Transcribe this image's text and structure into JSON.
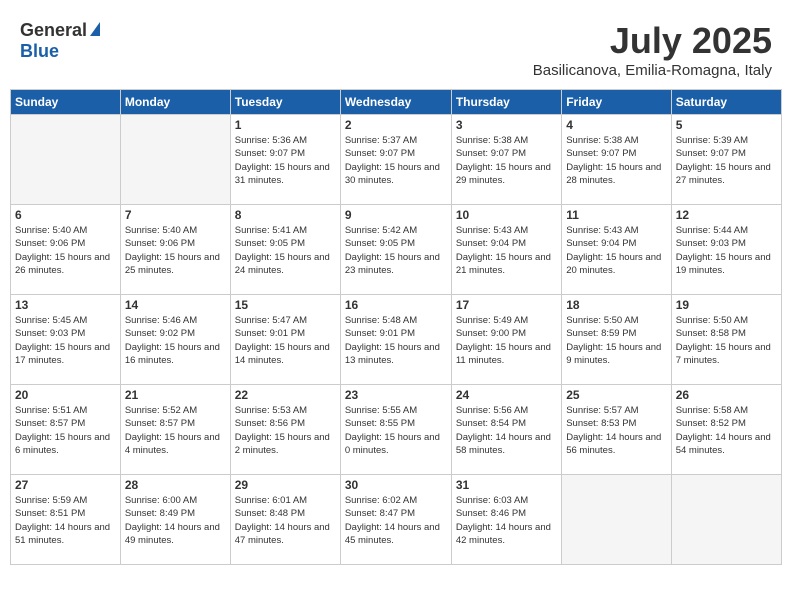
{
  "header": {
    "logo_general": "General",
    "logo_blue": "Blue",
    "month": "July 2025",
    "location": "Basilicanova, Emilia-Romagna, Italy"
  },
  "weekdays": [
    "Sunday",
    "Monday",
    "Tuesday",
    "Wednesday",
    "Thursday",
    "Friday",
    "Saturday"
  ],
  "weeks": [
    [
      {
        "day": "",
        "info": ""
      },
      {
        "day": "",
        "info": ""
      },
      {
        "day": "1",
        "info": "Sunrise: 5:36 AM\nSunset: 9:07 PM\nDaylight: 15 hours\nand 31 minutes."
      },
      {
        "day": "2",
        "info": "Sunrise: 5:37 AM\nSunset: 9:07 PM\nDaylight: 15 hours\nand 30 minutes."
      },
      {
        "day": "3",
        "info": "Sunrise: 5:38 AM\nSunset: 9:07 PM\nDaylight: 15 hours\nand 29 minutes."
      },
      {
        "day": "4",
        "info": "Sunrise: 5:38 AM\nSunset: 9:07 PM\nDaylight: 15 hours\nand 28 minutes."
      },
      {
        "day": "5",
        "info": "Sunrise: 5:39 AM\nSunset: 9:07 PM\nDaylight: 15 hours\nand 27 minutes."
      }
    ],
    [
      {
        "day": "6",
        "info": "Sunrise: 5:40 AM\nSunset: 9:06 PM\nDaylight: 15 hours\nand 26 minutes."
      },
      {
        "day": "7",
        "info": "Sunrise: 5:40 AM\nSunset: 9:06 PM\nDaylight: 15 hours\nand 25 minutes."
      },
      {
        "day": "8",
        "info": "Sunrise: 5:41 AM\nSunset: 9:05 PM\nDaylight: 15 hours\nand 24 minutes."
      },
      {
        "day": "9",
        "info": "Sunrise: 5:42 AM\nSunset: 9:05 PM\nDaylight: 15 hours\nand 23 minutes."
      },
      {
        "day": "10",
        "info": "Sunrise: 5:43 AM\nSunset: 9:04 PM\nDaylight: 15 hours\nand 21 minutes."
      },
      {
        "day": "11",
        "info": "Sunrise: 5:43 AM\nSunset: 9:04 PM\nDaylight: 15 hours\nand 20 minutes."
      },
      {
        "day": "12",
        "info": "Sunrise: 5:44 AM\nSunset: 9:03 PM\nDaylight: 15 hours\nand 19 minutes."
      }
    ],
    [
      {
        "day": "13",
        "info": "Sunrise: 5:45 AM\nSunset: 9:03 PM\nDaylight: 15 hours\nand 17 minutes."
      },
      {
        "day": "14",
        "info": "Sunrise: 5:46 AM\nSunset: 9:02 PM\nDaylight: 15 hours\nand 16 minutes."
      },
      {
        "day": "15",
        "info": "Sunrise: 5:47 AM\nSunset: 9:01 PM\nDaylight: 15 hours\nand 14 minutes."
      },
      {
        "day": "16",
        "info": "Sunrise: 5:48 AM\nSunset: 9:01 PM\nDaylight: 15 hours\nand 13 minutes."
      },
      {
        "day": "17",
        "info": "Sunrise: 5:49 AM\nSunset: 9:00 PM\nDaylight: 15 hours\nand 11 minutes."
      },
      {
        "day": "18",
        "info": "Sunrise: 5:50 AM\nSunset: 8:59 PM\nDaylight: 15 hours\nand 9 minutes."
      },
      {
        "day": "19",
        "info": "Sunrise: 5:50 AM\nSunset: 8:58 PM\nDaylight: 15 hours\nand 7 minutes."
      }
    ],
    [
      {
        "day": "20",
        "info": "Sunrise: 5:51 AM\nSunset: 8:57 PM\nDaylight: 15 hours\nand 6 minutes."
      },
      {
        "day": "21",
        "info": "Sunrise: 5:52 AM\nSunset: 8:57 PM\nDaylight: 15 hours\nand 4 minutes."
      },
      {
        "day": "22",
        "info": "Sunrise: 5:53 AM\nSunset: 8:56 PM\nDaylight: 15 hours\nand 2 minutes."
      },
      {
        "day": "23",
        "info": "Sunrise: 5:55 AM\nSunset: 8:55 PM\nDaylight: 15 hours\nand 0 minutes."
      },
      {
        "day": "24",
        "info": "Sunrise: 5:56 AM\nSunset: 8:54 PM\nDaylight: 14 hours\nand 58 minutes."
      },
      {
        "day": "25",
        "info": "Sunrise: 5:57 AM\nSunset: 8:53 PM\nDaylight: 14 hours\nand 56 minutes."
      },
      {
        "day": "26",
        "info": "Sunrise: 5:58 AM\nSunset: 8:52 PM\nDaylight: 14 hours\nand 54 minutes."
      }
    ],
    [
      {
        "day": "27",
        "info": "Sunrise: 5:59 AM\nSunset: 8:51 PM\nDaylight: 14 hours\nand 51 minutes."
      },
      {
        "day": "28",
        "info": "Sunrise: 6:00 AM\nSunset: 8:49 PM\nDaylight: 14 hours\nand 49 minutes."
      },
      {
        "day": "29",
        "info": "Sunrise: 6:01 AM\nSunset: 8:48 PM\nDaylight: 14 hours\nand 47 minutes."
      },
      {
        "day": "30",
        "info": "Sunrise: 6:02 AM\nSunset: 8:47 PM\nDaylight: 14 hours\nand 45 minutes."
      },
      {
        "day": "31",
        "info": "Sunrise: 6:03 AM\nSunset: 8:46 PM\nDaylight: 14 hours\nand 42 minutes."
      },
      {
        "day": "",
        "info": ""
      },
      {
        "day": "",
        "info": ""
      }
    ]
  ]
}
